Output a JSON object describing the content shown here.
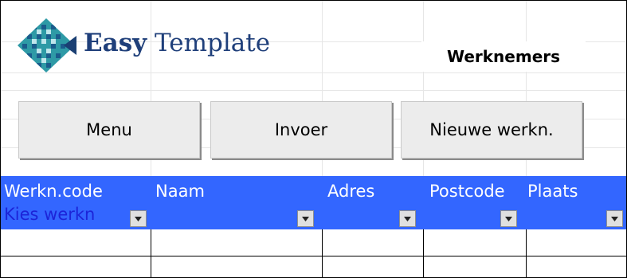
{
  "brand": {
    "bold": "Easy",
    "regular": " Template",
    "logo_icon": "diamond-grid-logo"
  },
  "sheet_title": "Werknemers",
  "buttons": {
    "menu": "Menu",
    "invoer": "Invoer",
    "nieuwe": "Nieuwe werkn."
  },
  "table": {
    "headers": [
      "Werkn.code",
      "Naam",
      "Adres",
      "Postcode",
      "Plaats"
    ],
    "selector_value": "Kies werkn",
    "dropdown_icon": "dropdown-arrow-icon"
  },
  "colors": {
    "header_band": "#3366ff",
    "selector_text": "#1c24d8",
    "brand_text": "#1f3f7a"
  }
}
